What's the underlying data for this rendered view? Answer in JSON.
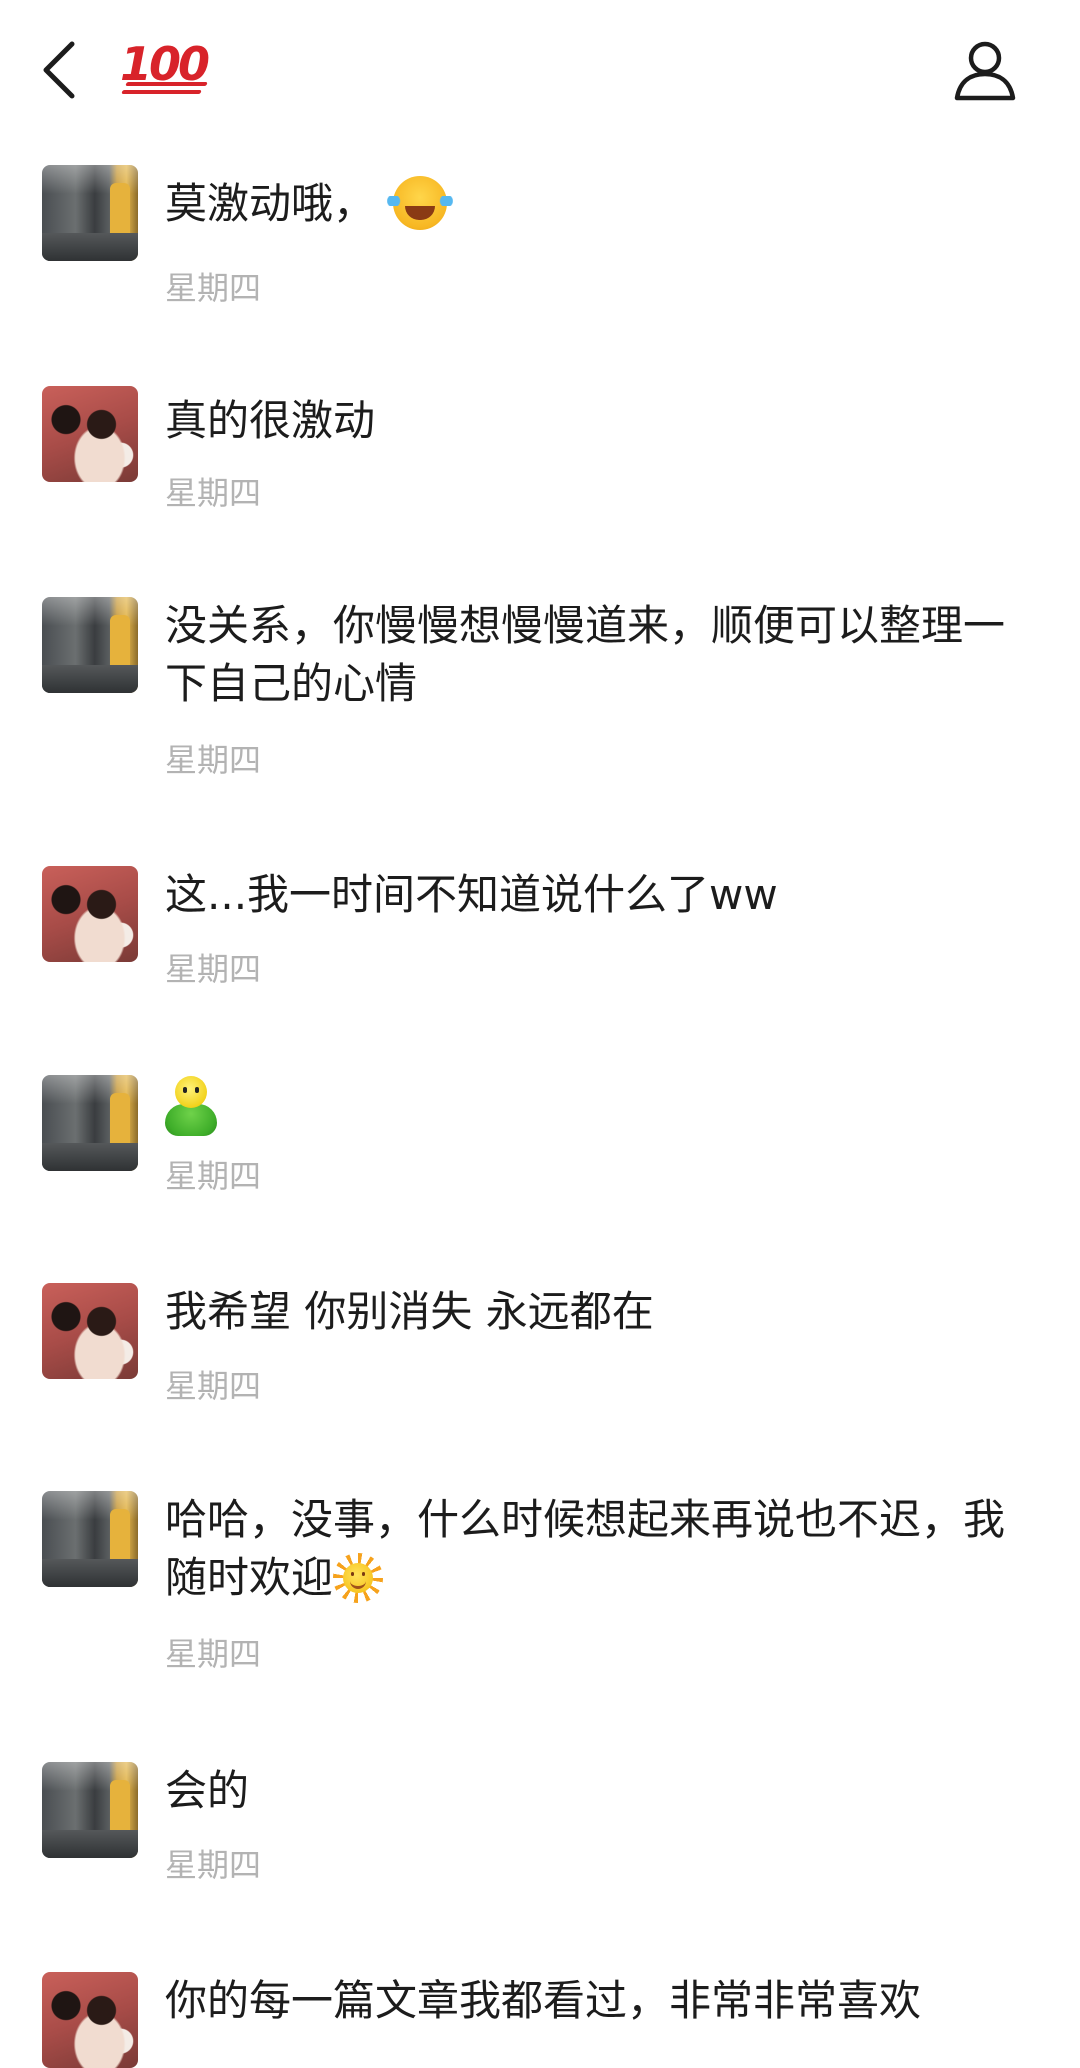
{
  "header": {
    "title_badge": "100",
    "back_icon": "chevron-left-icon",
    "profile_icon": "person-icon"
  },
  "messages": [
    {
      "avatar": "street",
      "text": "莫激动哦，",
      "emoji_after": "laughing-tears",
      "time": "星期四"
    },
    {
      "avatar": "couple",
      "text": "真的很激动",
      "time": "星期四"
    },
    {
      "avatar": "street",
      "text": "没关系，你慢慢想慢慢道来，顺便可以整理一下自己的心情",
      "time": "星期四"
    },
    {
      "avatar": "couple",
      "text": "这...我一时间不知道说什么了ww",
      "time": "星期四"
    },
    {
      "avatar": "street",
      "text": "",
      "emoji_only": "green-buddy",
      "time": "星期四"
    },
    {
      "avatar": "couple",
      "text": "我希望 你别消失 永远都在",
      "time": "星期四"
    },
    {
      "avatar": "street",
      "text": "哈哈，没事，什么时候想起来再说也不迟，我随时欢迎",
      "emoji_after": "sun-face",
      "time": "星期四"
    },
    {
      "avatar": "street",
      "text": "会的",
      "time": "星期四"
    },
    {
      "avatar": "couple",
      "text": "你的每一篇文章我都看过，非常非常喜欢",
      "time": ""
    }
  ]
}
